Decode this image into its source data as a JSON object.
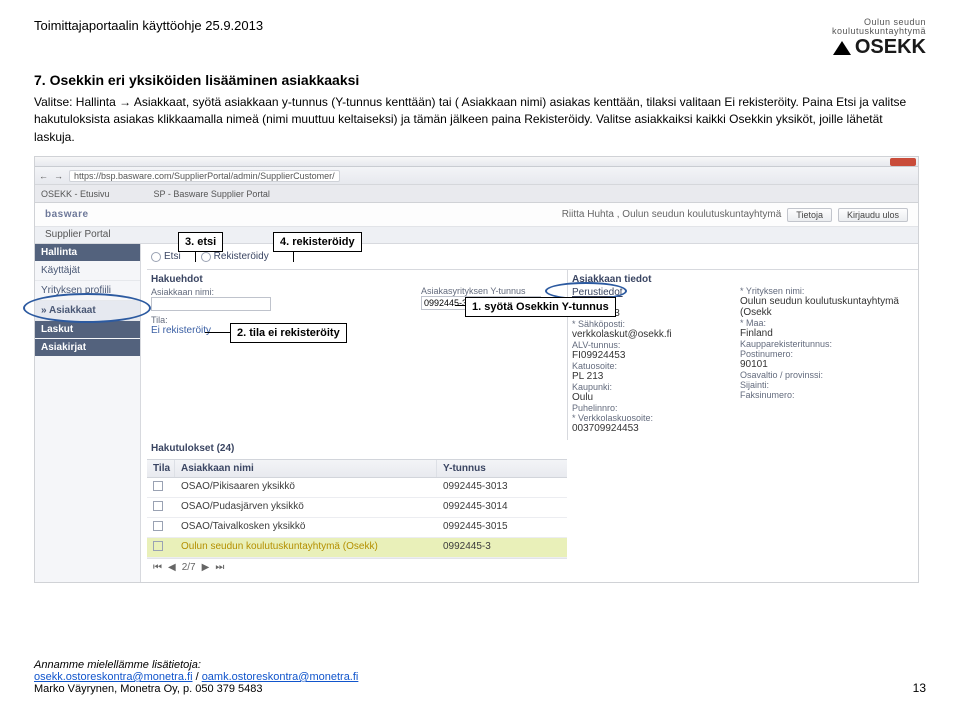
{
  "doc": {
    "header_title": "Toimittajaportaalin käyttöohje 25.9.2013",
    "logo_line1": "Oulun seudun",
    "logo_line2": "koulutuskuntayhtymä",
    "logo_brand": "OSEKK",
    "section_title": "7. Osekkin eri yksiköiden lisääminen asiakkaaksi",
    "para1": "Valitse: Hallinta → Asiakkaat, syötä asiakkaan y-tunnus (Y-tunnus kenttään) tai ( Asiakkaan nimi)  asiakas kenttään, tilaksi valitaan Ei rekisteröity. Paina Etsi ja valitse hakutuloksista asiakas klikkaamalla nimeä (nimi muuttuu keltaiseksi) ja tämän jälkeen paina Rekisteröidy. Valitse asiakkaiksi kaikki Osekkin yksiköt, joille lähetät laskuja.",
    "callouts": {
      "c1": "1. syötä Osekkin  Y-tunnus",
      "c2": "2. tila ei rekisteröity",
      "c3": "3. etsi",
      "c4": "4. rekisteröidy"
    }
  },
  "shot": {
    "url": "https://bsp.basware.com/SupplierPortal/admin/SupplierCustomer/",
    "tab1": "OSEKK - Etusivu",
    "tab2": "SP - Basware Supplier Portal",
    "brand": "basware",
    "user": "Riitta Huhta , Oulun seudun koulutuskuntayhtymä",
    "btn_tietoja": "Tietoja",
    "btn_kirjaudu": "Kirjaudu ulos",
    "portal_label": "Supplier Portal",
    "sidebar": {
      "hallinta": "Hallinta",
      "items": [
        "Käyttäjät",
        "Yrityksen profiili",
        "» Asiakkaat"
      ],
      "laskut": "Laskut",
      "asiakirjat": "Asiakirjat"
    },
    "toolbar": {
      "etsi": "Etsi",
      "rek": "Rekisteröidy"
    },
    "panels": {
      "haku_title": "Hakuehdot",
      "asnimi_label": "Asiakkaan nimi:",
      "asnimi_val": "",
      "tila_label": "Tila:",
      "tila_link": "Ei rekisteröity",
      "ytun_label": "Asiakasyrityksen Y-tunnus",
      "ytun_val": "0992445-3",
      "asitiedot_title": "Asiakkaan tiedot",
      "perustiedot": "Perustiedot",
      "ytun2_label": "* Y-tunnus:",
      "ytun2_val": "0992445-3",
      "sposti_label": "* Sähköposti:",
      "sposti_val": "verkkolaskut@osekk.fi",
      "alv_label": "ALV-tunnus:",
      "alv_val": "FI09924453",
      "katu_label": "Katuosoite:",
      "katu_val": "PL 213",
      "kaup_label": "Kaupunki:",
      "kaup_val": "Oulu",
      "puh_label": "Puhelinnro:",
      "puh_val": "",
      "verkko_label": "* Verkkolaskuosoite:",
      "verkko_val": "003709924453",
      "yritys_label": "* Yrityksen nimi:",
      "yritys_val": "Oulun seudun koulutuskuntayhtymä (Osekk",
      "maa_label": "* Maa:",
      "maa_val": "Finland",
      "kaupparek_label": "Kaupparekisteritunnus:",
      "kaupparek_val": "",
      "postinro_label": "Postinumero:",
      "postinro_val": "90101",
      "osav_label": "Osavaltio / provinssi:",
      "osav_val": "",
      "sij_label": "Sijainti:",
      "sij_val": "",
      "faksi_label": "Faksinumero:",
      "faksi_val": ""
    },
    "table": {
      "title": "Hakutulokset (24)",
      "col_tila": "Tila",
      "col_nimi": "Asiakkaan nimi",
      "col_ytun": "Y-tunnus",
      "rows": [
        {
          "nimi": "OSAO/Pikisaaren yksikkö",
          "y": "0992445-3013"
        },
        {
          "nimi": "OSAO/Pudasjärven yksikkö",
          "y": "0992445-3014"
        },
        {
          "nimi": "OSAO/Taivalkosken yksikkö",
          "y": "0992445-3015"
        },
        {
          "nimi": "Oulun seudun koulutuskuntayhtymä (Osekk)",
          "y": "0992445-3"
        }
      ],
      "pager": "2/7"
    }
  },
  "footer": {
    "line1": "Annamme mielellämme lisätietoja:",
    "mail1": "osekk.ostoreskontra@monetra.fi",
    "sep": " / ",
    "mail2": "oamk.ostoreskontra@monetra.fi",
    "line3a": "Marko Väyrynen, Monetra Oy, p. ",
    "line3b": "050 379 5483",
    "page": "13"
  }
}
